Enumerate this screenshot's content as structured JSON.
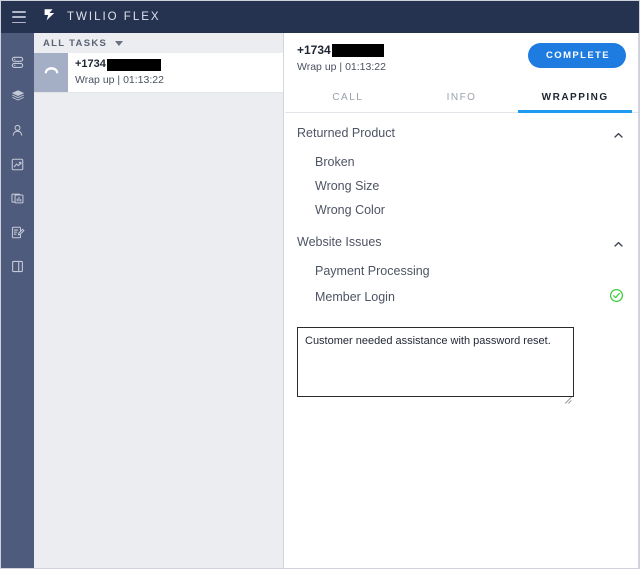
{
  "topbar": {
    "menu_icon": "hamburger-menu-icon",
    "logo_icon": "twilio-logo-icon",
    "brand": "TWILIO FLEX",
    "background": "#263350"
  },
  "sidebar": {
    "background": "#4f5b7c",
    "items": [
      {
        "icon": "agent-desktop-icon",
        "name": "sidebar-item-agent-desktop"
      },
      {
        "icon": "layers-icon",
        "name": "sidebar-item-queues"
      },
      {
        "icon": "agents-person-icon",
        "name": "sidebar-item-agents"
      },
      {
        "icon": "insights-chart-icon",
        "name": "sidebar-item-insights"
      },
      {
        "icon": "reports-panels-icon",
        "name": "sidebar-item-reports"
      },
      {
        "icon": "form-edit-icon",
        "name": "sidebar-item-forms"
      },
      {
        "icon": "book-panel-icon",
        "name": "sidebar-item-library"
      }
    ]
  },
  "task_list": {
    "filter_label": "ALL TASKS",
    "filter_caret": "chevron-down-icon",
    "background": "#ecedf1",
    "tasks": [
      {
        "channel_icon": "phone-hangup-icon",
        "avatar_color": "#a4aec4",
        "number_prefix": "+1734",
        "number_redacted": true,
        "status": "Wrap up",
        "separator": "|",
        "timer": "01:13:22",
        "selected": true
      }
    ]
  },
  "detail": {
    "number_prefix": "+1734",
    "number_redacted": true,
    "status": "Wrap up",
    "separator": "|",
    "timer": "01:13:22",
    "complete_label": "COMPLETE",
    "complete_color": "#1e7ce0",
    "tabs": [
      {
        "label": "CALL",
        "active": false
      },
      {
        "label": "INFO",
        "active": false
      },
      {
        "label": "WRAPPING",
        "active": true
      }
    ],
    "active_tab_underline": "#1e9bf0",
    "sections": [
      {
        "title": "Returned Product",
        "expanded": true,
        "chevron": "chevron-up-icon",
        "items": [
          {
            "label": "Broken",
            "selected": false
          },
          {
            "label": "Wrong Size",
            "selected": false
          },
          {
            "label": "Wrong Color",
            "selected": false
          }
        ]
      },
      {
        "title": "Website Issues",
        "expanded": true,
        "chevron": "chevron-up-icon",
        "items": [
          {
            "label": "Payment Processing",
            "selected": false
          },
          {
            "label": "Member Login",
            "selected": true,
            "selected_icon": "check-circle-icon",
            "selected_color": "#3ccc3c"
          }
        ]
      }
    ],
    "notes": {
      "value": "Customer needed assistance with password reset.",
      "placeholder": "",
      "resize_handle": "resize-grip-icon"
    }
  }
}
